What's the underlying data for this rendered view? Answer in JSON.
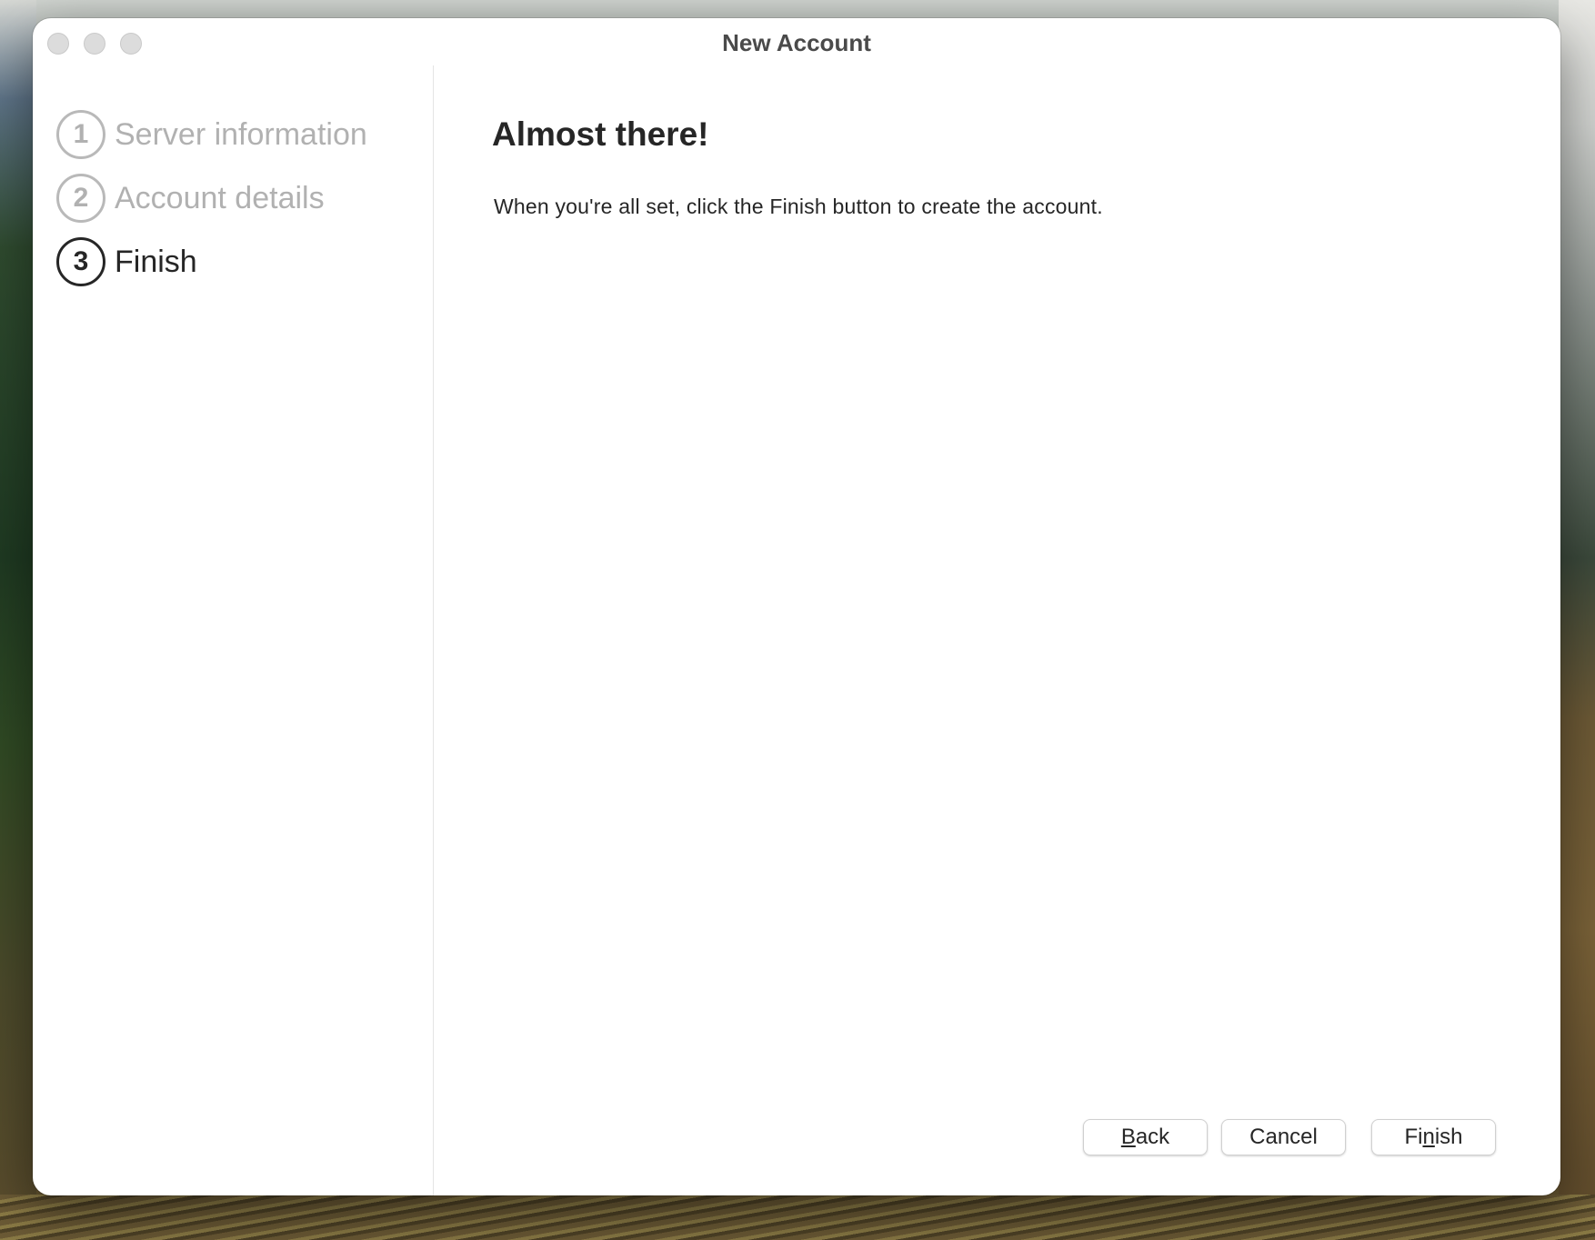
{
  "window": {
    "title": "New Account"
  },
  "wizard": {
    "steps": [
      {
        "number": "1",
        "label": "Server information",
        "state": "completed"
      },
      {
        "number": "2",
        "label": "Account details",
        "state": "completed"
      },
      {
        "number": "3",
        "label": "Finish",
        "state": "current"
      }
    ]
  },
  "content": {
    "heading": "Almost there!",
    "description": "When you're all set, click the Finish button to create the account."
  },
  "buttons": {
    "back": {
      "mnemonic": "B",
      "rest": "ack"
    },
    "cancel": {
      "label": "Cancel"
    },
    "finish": {
      "before": "Fi",
      "mnemonic": "n",
      "after": "ish"
    }
  },
  "colors": {
    "active_text": "#262626",
    "inactive_text": "#b1b1b1",
    "window_background": "#ffffff"
  }
}
